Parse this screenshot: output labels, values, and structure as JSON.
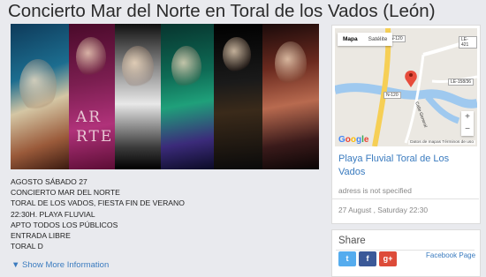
{
  "page": {
    "title": "Concierto Mar del Norte en Toral de los Vados (León)"
  },
  "hero": {
    "overlay_text_line1": "AR",
    "overlay_text_line2": "RTE"
  },
  "description": {
    "lines": [
      "AGOSTO SÁBADO 27",
      "CONCIERTO MAR DEL NORTE",
      "TORAL DE LOS VADOS, FIESTA FIN DE VERANO",
      "22:30H. PLAYA FLUVIAL",
      "APTO TODOS LOS PÚBLICOS",
      "ENTRADA LIBRE",
      "TORAL D"
    ],
    "show_more": "▼ Show More Information"
  },
  "map": {
    "tab_map": "Mapa",
    "tab_satellite": "Satélite",
    "zoom_in": "+",
    "zoom_out": "−",
    "google": "Google",
    "footer": "Datos de mapas   Términos de uso",
    "road_n120": "N-120",
    "road_le421": "LE-421",
    "road_le158": "LE-158/36",
    "road_n120b": "N-120",
    "street": "Calle General"
  },
  "venue": {
    "name": "Playa Fluvial Toral de Los Vados",
    "address": "adress is not specified",
    "date": "27 August , Saturday 22:30"
  },
  "share": {
    "title": "Share",
    "twitter": "t",
    "facebook": "f",
    "google_plus": "g+",
    "facebook_page": "Facebook Page"
  },
  "colors": {
    "link": "#3a7bbf",
    "twitter": "#55acee",
    "facebook": "#3b5998",
    "google_plus": "#dd4b39",
    "background": "#e9eaee"
  }
}
